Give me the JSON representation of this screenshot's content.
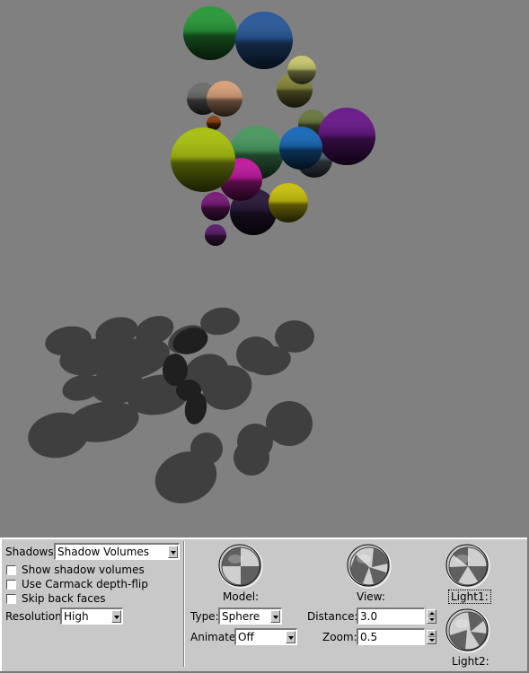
{
  "viewport": {
    "background": "#808080",
    "scene": "shadow-volumes-spheres"
  },
  "shadows_group": {
    "shadows_label": "Shadows:",
    "shadows_value": "Shadow Volumes",
    "checkboxes": [
      {
        "label": "Show shadow volumes",
        "checked": false
      },
      {
        "label": "Use Carmack depth-flip",
        "checked": false
      },
      {
        "label": "Skip back faces",
        "checked": false
      }
    ],
    "resolution_label": "Resolution:",
    "resolution_value": "High"
  },
  "model_group": {
    "trackball_label": "Model:",
    "type_label": "Type:",
    "type_value": "Sphere",
    "animate_label": "Animate:",
    "animate_value": "Off"
  },
  "view_group": {
    "trackball_label": "View:",
    "distance_label": "Distance:",
    "distance_value": "3.0",
    "zoom_label": "Zoom:",
    "zoom_value": "0.5"
  },
  "lights_group": {
    "light1_label": "Light1:",
    "light2_label": "Light2:"
  },
  "colors": {
    "panel_bg": "#c8c8c8",
    "shadow": "#3f3f3f",
    "shadow_overlap": "#1f1f1f"
  }
}
